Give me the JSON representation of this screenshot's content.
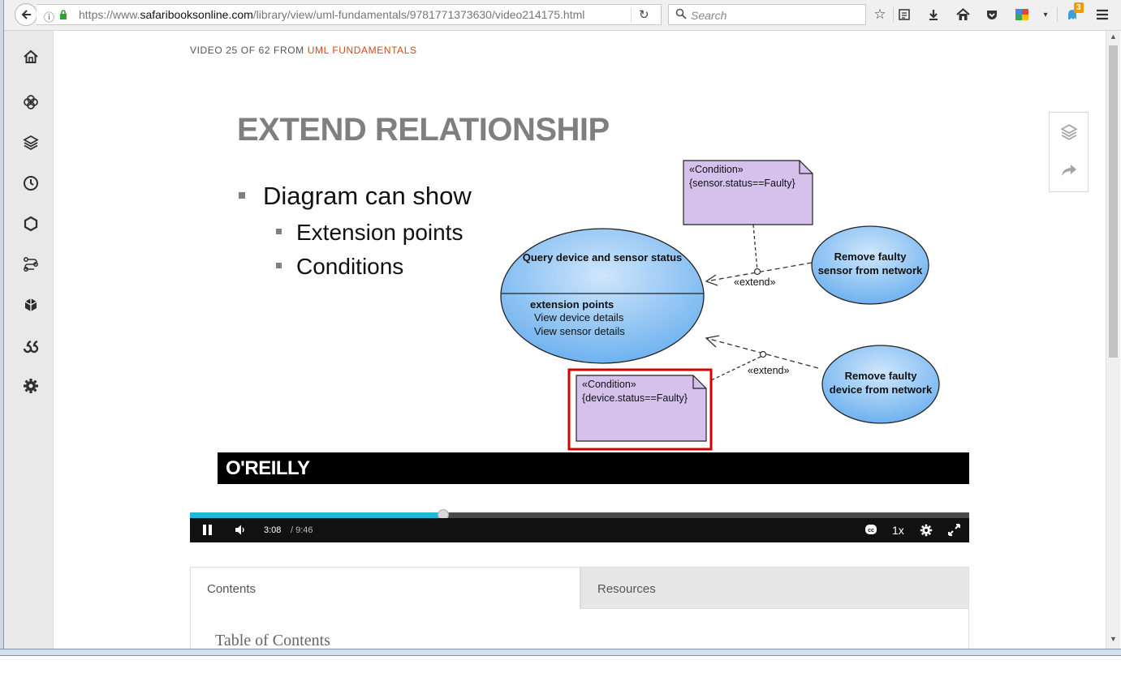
{
  "browser": {
    "url_prefix": "https://www.",
    "url_host": "safaribooksonline.com",
    "url_path": "/library/view/uml-fundamentals/9781771373630/video214175.html",
    "search_placeholder": "Search",
    "notification_count": "3"
  },
  "page": {
    "video_label_prefix": "VIDEO 25 OF 62 FROM",
    "course_name": "UML FUNDAMENTALS"
  },
  "slide": {
    "title": "EXTEND RELATIONSHIP",
    "bullet_main": "Diagram can show",
    "bullet_sub_1": "Extension points",
    "bullet_sub_2": "Conditions",
    "condition_top_stereotype": "«Condition»",
    "condition_top_expr": "{sensor.status==Faulty}",
    "condition_bottom_stereotype": "«Condition»",
    "condition_bottom_expr": "{device.status==Faulty}",
    "usecase_main_title": "Query device and sensor status",
    "extension_points_label": "extension points",
    "extension_point_1": "View device details",
    "extension_point_2": "View sensor details",
    "usecase_sensor_line1": "Remove faulty",
    "usecase_sensor_line2": "sensor from network",
    "usecase_device_line1": "Remove faulty",
    "usecase_device_line2": "device from network",
    "extend_label_1": "«extend»",
    "extend_label_2": "«extend»",
    "brand": "O'REILLY"
  },
  "player": {
    "current_time": "3:08",
    "total_time": "/ 9:46",
    "progress": 0.325,
    "speed": "1x"
  },
  "tabs": {
    "contents": "Contents",
    "resources": "Resources",
    "toc_heading": "Table of Contents"
  },
  "colors": {
    "accent_orange": "#d4491a",
    "progress_blue": "#24b6d8",
    "usecase_blue": "#8ec5f5",
    "note_purple": "#d5c1ec",
    "highlight_red": "#d40000"
  }
}
